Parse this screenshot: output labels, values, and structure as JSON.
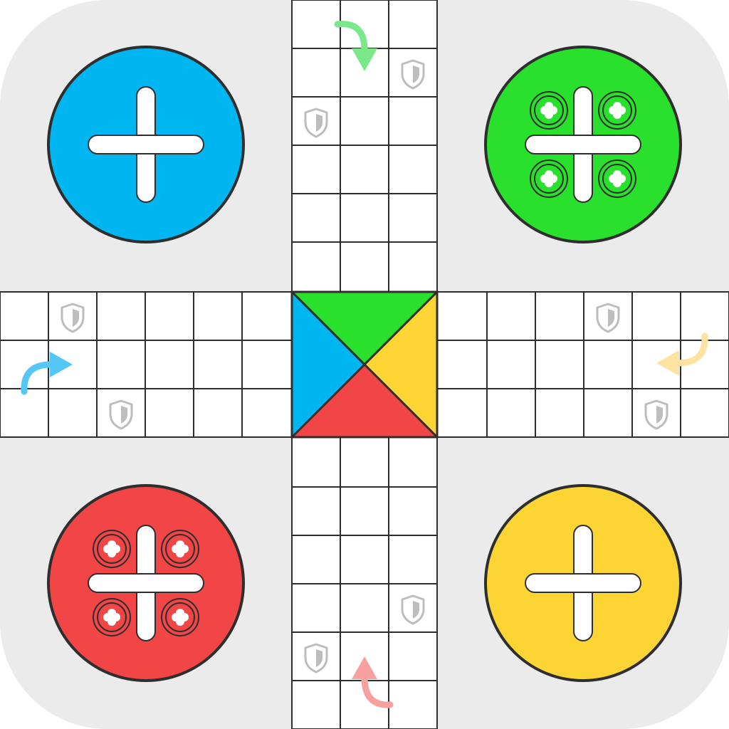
{
  "game": "ludo",
  "colors": {
    "background": "#ebebeb",
    "grid_line": "#2e2e2e",
    "cell": "#ffffff",
    "blue": "#00b6f1",
    "green": "#29e02c",
    "red": "#f24646",
    "yellow": "#fcd535",
    "shield": "#bdbdbd"
  },
  "home_bases": [
    {
      "player": "blue",
      "color": "#00b6f1",
      "tokens_in_base": 0,
      "corner": "top-left"
    },
    {
      "player": "green",
      "color": "#29e02c",
      "tokens_in_base": 4,
      "corner": "top-right"
    },
    {
      "player": "red",
      "color": "#f24646",
      "tokens_in_base": 4,
      "corner": "bottom-left"
    },
    {
      "player": "yellow",
      "color": "#fcd535",
      "tokens_in_base": 0,
      "corner": "bottom-right"
    }
  ],
  "center": {
    "triangles": [
      {
        "side": "top",
        "color": "#29e02c"
      },
      {
        "side": "right",
        "color": "#fcd535"
      },
      {
        "side": "bottom",
        "color": "#f24646"
      },
      {
        "side": "left",
        "color": "#00b6f1"
      }
    ]
  },
  "start_arrows": [
    {
      "player": "green",
      "color": "#7be889",
      "arm": "top"
    },
    {
      "player": "yellow",
      "color": "#fde3a1",
      "arm": "right"
    },
    {
      "player": "red",
      "color": "#f7a0a0",
      "arm": "bottom"
    },
    {
      "player": "blue",
      "color": "#55c6f5",
      "arm": "left"
    }
  ],
  "safe_squares": [
    {
      "arm": "top",
      "row": 1,
      "col": 2
    },
    {
      "arm": "top",
      "row": 2,
      "col": 0
    },
    {
      "arm": "left",
      "row": 0,
      "col": 1
    },
    {
      "arm": "left",
      "row": 2,
      "col": 2
    },
    {
      "arm": "right",
      "row": 0,
      "col": 3
    },
    {
      "arm": "right",
      "row": 2,
      "col": 4
    },
    {
      "arm": "bottom",
      "row": 3,
      "col": 2
    },
    {
      "arm": "bottom",
      "row": 4,
      "col": 0
    }
  ]
}
